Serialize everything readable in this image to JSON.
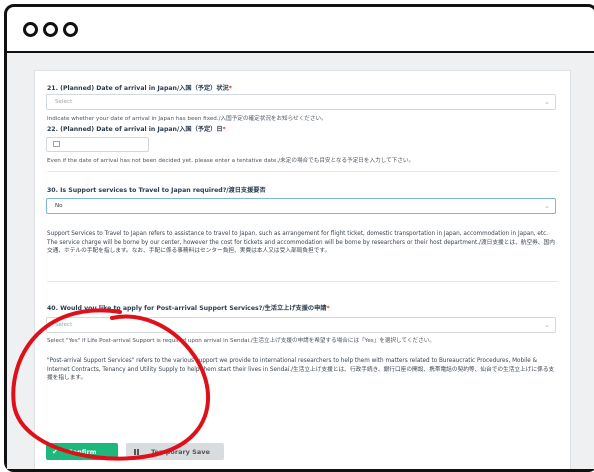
{
  "window": {
    "controls": [
      "close",
      "minimize",
      "maximize"
    ]
  },
  "form": {
    "q21": {
      "label": "21. (Planned) Date of arrival in Japan/入国（予定）状況",
      "required_mark": "*",
      "select_placeholder": "Select",
      "hint": "Indicate whether your date of arrival in Japan has been fixed./入国予定の確定状況をお知らせください。"
    },
    "q22": {
      "label": "22. (Planned) Date of arrival in Japan/入国（予定）日",
      "required_mark": "*",
      "hint": "Even if the date of arrival has not been decided yet, please enter a tentative date./未定の場合でも目安となる予定日を入力して下さい。"
    },
    "q30": {
      "label": "30. Is Support services to Travel to Japan required?/渡日支援要否",
      "value": "No",
      "para": "Support Services to Travel to Japan refers to assistance to travel to Japan, such as arrangement for flight ticket, domestic transportation in Japan, accommodation in Japan, etc. The service charge will be borne by our center, however the cost for tickets and accommodation will be borne by researchers or their host department./渡日支援とは、航空券、国内交通、ホテルの手配を指します。なお、手配に係る事務料はセンター負担、実費は本人又は受入部局負担です。"
    },
    "q40": {
      "label": "40. Would you like to apply for Post-arrival Support Services?/生活立上げ支援の申請",
      "required_mark": "*",
      "select_placeholder": "Select",
      "hint": "Select \"Yes\" if Life Post-arrival Support is required upon arrival in Sendai./生活立上げ支援の申請を希望する場合には「Yes」を選択してください。",
      "para": "\"Post-arrival Support Services\" refers to the various support we provide to international researchers to help them with matters related to Bureaucratic Procedures, Mobile & Internet Contracts, Tenancy and Utility Supply to help them start their lives in Sendai./生活立上げ支援とは、行政手続き、銀行口座の開設、携帯電話の契約等、仙台での生活立上げに係る支援を指します。"
    },
    "buttons": {
      "confirm": "Confirm",
      "temporary_save": "Temporary Save"
    }
  },
  "colors": {
    "confirm": "#1db97c",
    "annotation": "#e0101a"
  }
}
